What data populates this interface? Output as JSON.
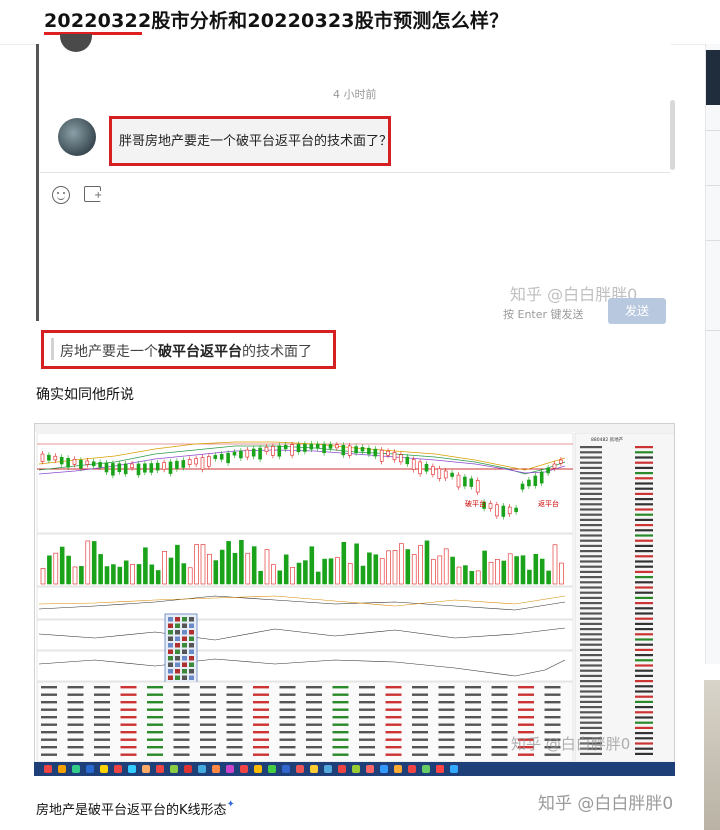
{
  "question_title": "20220322股市分析和20220323股市预测怎么样？",
  "chat": {
    "timestamp": "4 小时前",
    "message": "胖哥房地产要走一个破平台返平台的技术面了？",
    "watermark": "知乎 @白白胖胖0",
    "input_hint": "按 Enter 键发送",
    "send_label": "发送"
  },
  "quote": {
    "prefix": "房地产要走一个",
    "bold1": "破平台返平台",
    "suffix": "的技术面了"
  },
  "answer_text": "确实如同他所说",
  "stock_chart": {
    "annotation_left": "破平台",
    "annotation_right": "返平台",
    "panel_title": "880482 房地产",
    "watermark": "知乎 @白白胖胖0"
  },
  "caption": "房地产是破平台返平台的K线形态",
  "bottom_watermark": "知乎 @白白胖胖0",
  "colors": {
    "highlight_box": "#d42020",
    "up_candle": "#e02020",
    "down_candle": "#1aa31a",
    "taskbar": "#1f3f78"
  }
}
